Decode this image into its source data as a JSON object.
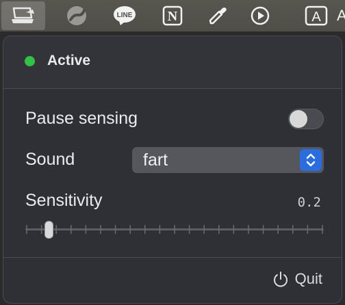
{
  "menubar": {
    "items": [
      {
        "name": "laptop-sensor-icon"
      },
      {
        "name": "trend-icon"
      },
      {
        "name": "line-icon",
        "label": "LINE"
      },
      {
        "name": "notion-icon",
        "label": "N"
      },
      {
        "name": "eyedropper-icon"
      },
      {
        "name": "play-icon"
      },
      {
        "name": "input-source-icon",
        "label": "A"
      }
    ],
    "trailing_text": "A"
  },
  "status": {
    "label": "Active",
    "color": "#31c246"
  },
  "pause_sensing": {
    "label": "Pause sensing",
    "enabled": false
  },
  "sound": {
    "label": "Sound",
    "value": "fart"
  },
  "sensitivity": {
    "label": "Sensitivity",
    "value_text": "0.2",
    "value": 0.2
  },
  "footer": {
    "quit_label": "Quit"
  },
  "colors": {
    "accent": "#2a6de0",
    "status_green": "#31c246"
  }
}
